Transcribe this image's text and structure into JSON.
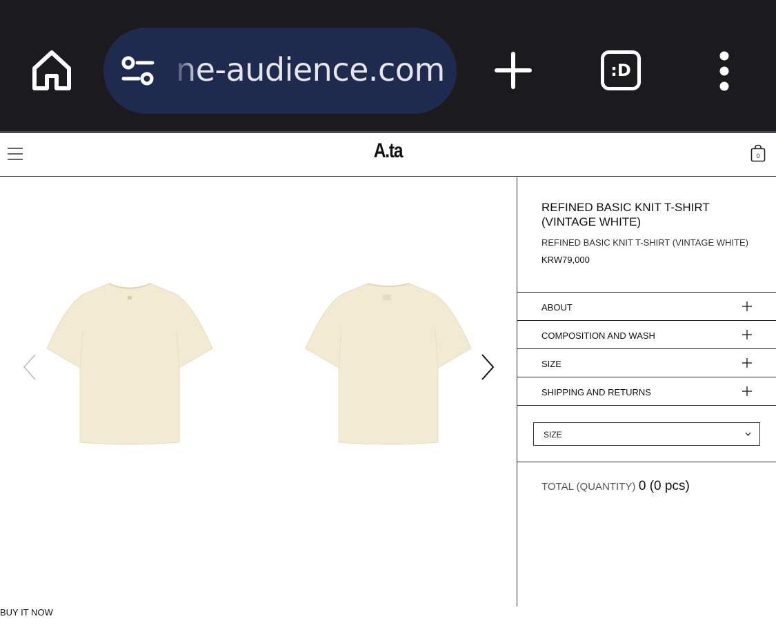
{
  "browser": {
    "url": "ne-audience.com",
    "tabs_label": ":D"
  },
  "site": {
    "logo": "A.ta",
    "cart_count": "0"
  },
  "product": {
    "title": "REFINED BASIC KNIT T-SHIRT (VINTAGE WHITE)",
    "subtitle": "REFINED BASIC KNIT T-SHIRT (VINTAGE WHITE)",
    "price": "KRW79,000",
    "shirt_color": "#f3ead2"
  },
  "accordion": [
    {
      "label": "ABOUT"
    },
    {
      "label": "COMPOSITION AND WASH"
    },
    {
      "label": "SIZE"
    },
    {
      "label": "SHIPPING AND RETURNS"
    }
  ],
  "size_select": {
    "label": "SIZE"
  },
  "total": {
    "label": "TOTAL (QUANTITY)",
    "value": "0 (0 pcs)"
  },
  "buy_now": "BUY IT NOW",
  "icons": {
    "home": "home-icon",
    "site_settings": "site-settings-icon",
    "new_tab": "plus-icon",
    "menu": "more-vertical-icon",
    "hamburger": "hamburger-icon",
    "cart": "shopping-bag-icon",
    "prev": "chevron-left-icon",
    "next": "chevron-right-icon",
    "expand": "plus-icon",
    "dropdown": "chevron-down-icon"
  }
}
